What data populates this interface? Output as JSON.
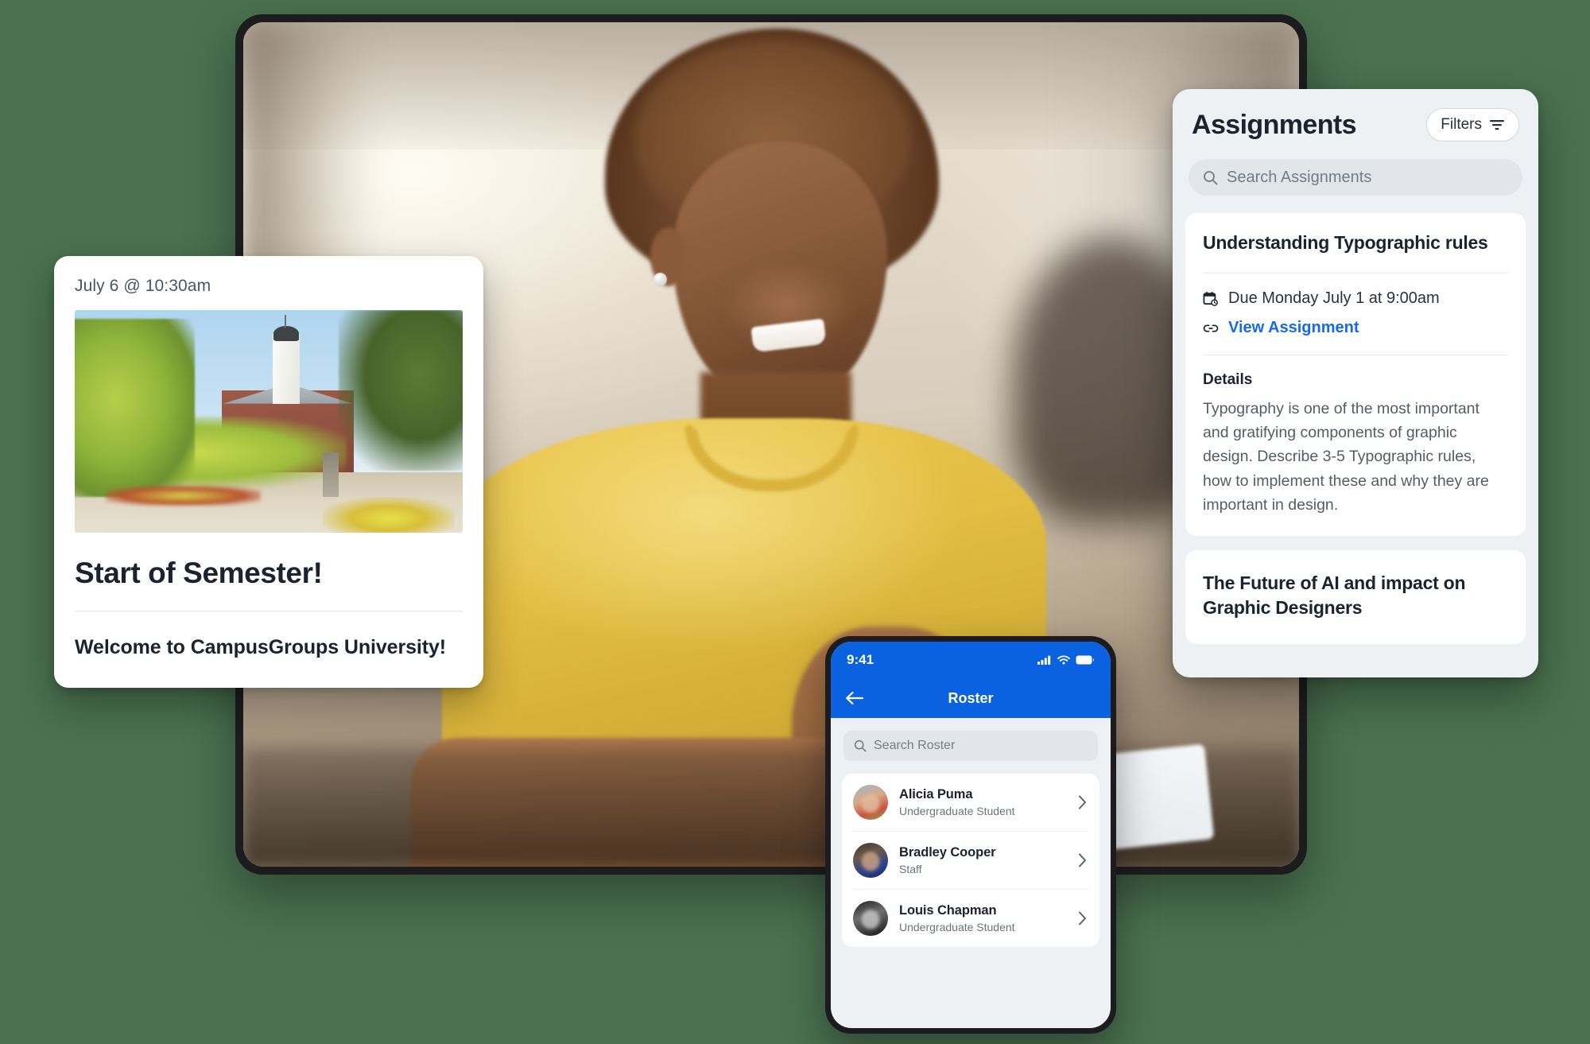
{
  "theme": {
    "background_green": "#4a7150",
    "brand_blue": "#0a62e0",
    "link_blue": "#1868ee",
    "panel_grey": "#eef1f4",
    "text_dark": "#1d2230",
    "text_muted": "#545c67"
  },
  "event_card": {
    "date": "July 6 @ 10:30am",
    "photo_alt": "campus-building-photo",
    "title": "Start of Semester!",
    "body": "Welcome to CampusGroups University!"
  },
  "assignments_panel": {
    "title": "Assignments",
    "filters_label": "Filters",
    "search_placeholder": "Search Assignments",
    "cards": [
      {
        "title": "Understanding Typographic rules",
        "due": "Due Monday July 1 at 9:00am",
        "link_label": "View Assignment",
        "details_label": "Details",
        "details_text": "Typography is one of the most important and gratifying components of graphic design. Describe 3-5 Typographic rules, how to implement these and why they are important in design."
      },
      {
        "title": "The Future of AI and impact on Graphic Designers"
      }
    ]
  },
  "phone": {
    "status_time": "9:41",
    "nav_title": "Roster",
    "search_placeholder": "Search Roster",
    "roster": [
      {
        "name": "Alicia Puma",
        "role": "Undergraduate Student"
      },
      {
        "name": "Bradley Cooper",
        "role": "Staff"
      },
      {
        "name": "Louis Chapman",
        "role": "Undergraduate Student"
      }
    ]
  }
}
